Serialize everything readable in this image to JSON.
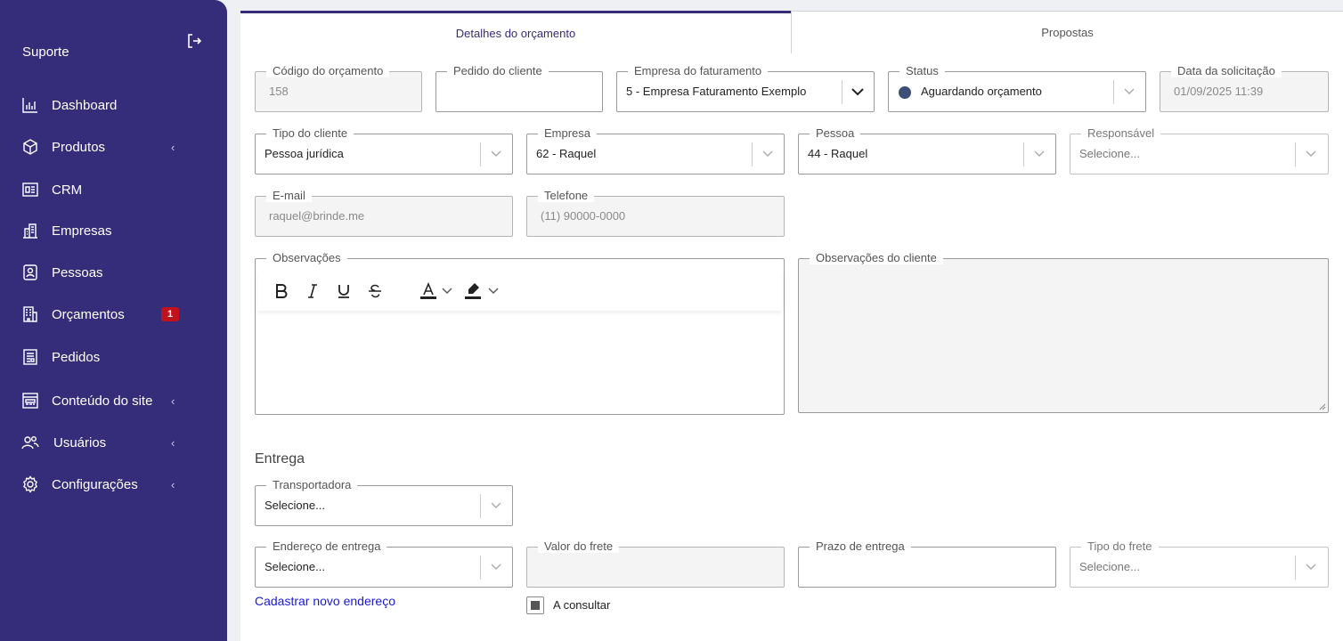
{
  "sidebar": {
    "brand": "Suporte",
    "items": [
      {
        "label": "Dashboard",
        "icon": "chart-bar-icon"
      },
      {
        "label": "Produtos",
        "icon": "box-icon",
        "chevron": "‹"
      },
      {
        "label": "CRM",
        "icon": "crm-board-icon"
      },
      {
        "label": "Empresas",
        "icon": "building-icon"
      },
      {
        "label": "Pessoas",
        "icon": "person-card-icon"
      },
      {
        "label": "Orçamentos",
        "icon": "budget-building-icon",
        "badge": "1"
      },
      {
        "label": "Pedidos",
        "icon": "document-icon"
      },
      {
        "label": "Conteúdo do site",
        "icon": "site-layout-icon",
        "chevron": "‹"
      },
      {
        "label": "Usuários",
        "icon": "users-icon",
        "chevron": "‹"
      },
      {
        "label": "Configurações",
        "icon": "gear-icon",
        "chevron": "‹"
      }
    ]
  },
  "tabs": {
    "active": "Detalhes do orçamento",
    "other": "Propostas"
  },
  "fields": {
    "codigo": {
      "label": "Código do orçamento",
      "value": "158"
    },
    "pedido": {
      "label": "Pedido do cliente",
      "value": ""
    },
    "empresa_fat": {
      "label": "Empresa do faturamento",
      "value": "5 - Empresa Faturamento Exemplo"
    },
    "status": {
      "label": "Status",
      "value": "Aguardando orçamento"
    },
    "data": {
      "label": "Data da solicitação",
      "value": "01/09/2025 11:39"
    },
    "tipo_cliente": {
      "label": "Tipo do cliente",
      "value": "Pessoa jurídica"
    },
    "empresa": {
      "label": "Empresa",
      "value": "62 - Raquel"
    },
    "pessoa": {
      "label": "Pessoa",
      "value": "44 - Raquel"
    },
    "responsavel": {
      "label": "Responsável",
      "placeholder": "Selecione..."
    },
    "email": {
      "label": "E-mail",
      "value": "raquel@brinde.me"
    },
    "telefone": {
      "label": "Telefone",
      "value": "(11) 90000-0000"
    },
    "observacoes": {
      "label": "Observações"
    },
    "obs_cliente": {
      "label": "Observações do cliente"
    },
    "transportadora": {
      "label": "Transportadora",
      "placeholder": "Selecione..."
    },
    "endereco": {
      "label": "Endereço de entrega",
      "placeholder": "Selecione..."
    },
    "valor_frete": {
      "label": "Valor do frete",
      "value": ""
    },
    "prazo": {
      "label": "Prazo de entrega",
      "value": ""
    },
    "tipo_frete": {
      "label": "Tipo do frete",
      "placeholder": "Selecione..."
    }
  },
  "entrega": {
    "title": "Entrega",
    "new_address_link": "Cadastrar novo endereço",
    "a_consultar": "A consultar"
  },
  "colors": {
    "sidebar_bg": "#362d7a",
    "badge": "#c0121b",
    "status_dot": "#3c4f74",
    "link": "#1a1acc"
  }
}
